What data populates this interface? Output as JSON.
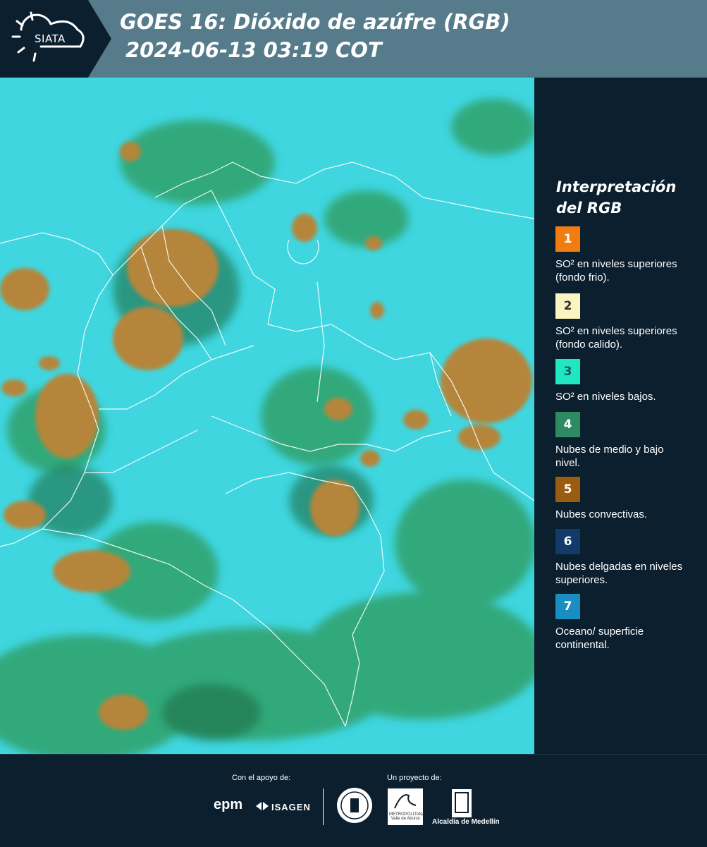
{
  "header": {
    "logo_text": "SIATA",
    "title_line1": "GOES 16: Dióxido de azúfre (RGB)",
    "title_line2": "2024-06-13 03:19 COT"
  },
  "legend": {
    "title_line1": "Interpretación",
    "title_line2": "del RGB",
    "items": [
      {
        "number": "1",
        "label": "SO² en niveles superiores (fondo frio).",
        "color": "#f07d12"
      },
      {
        "number": "2",
        "label": "SO² en niveles superiores (fondo calido).",
        "color": "#fbf4c0"
      },
      {
        "number": "3",
        "label": "SO² en niveles bajos.",
        "color": "#20e6c2"
      },
      {
        "number": "4",
        "label": "Nubes de medio y bajo nivel.",
        "color": "#2e8a62"
      },
      {
        "number": "5",
        "label": "Nubes convectivas.",
        "color": "#9a5c10"
      },
      {
        "number": "6",
        "label": "Nubes delgadas en niveles superiores.",
        "color": "#123a6a"
      },
      {
        "number": "7",
        "label": "Oceano/ superficie continental.",
        "color": "#1a8ec0"
      }
    ]
  },
  "footer": {
    "support_label": "Con el apoyo de:",
    "project_label": "Un proyecto de:",
    "sponsor1": "epm",
    "sponsor2": "ISAGEN",
    "partner1": "METROPOLITANA Valle de Aburrá",
    "partner2": "Alcaldía de Medellín"
  },
  "colors": {
    "header_bg": "#567c8c",
    "panel_bg": "#0b1f2e",
    "ocean_cyan": "#3fd6e0",
    "convective": "#b5853a",
    "low_cloud": "#2e9a5a"
  }
}
